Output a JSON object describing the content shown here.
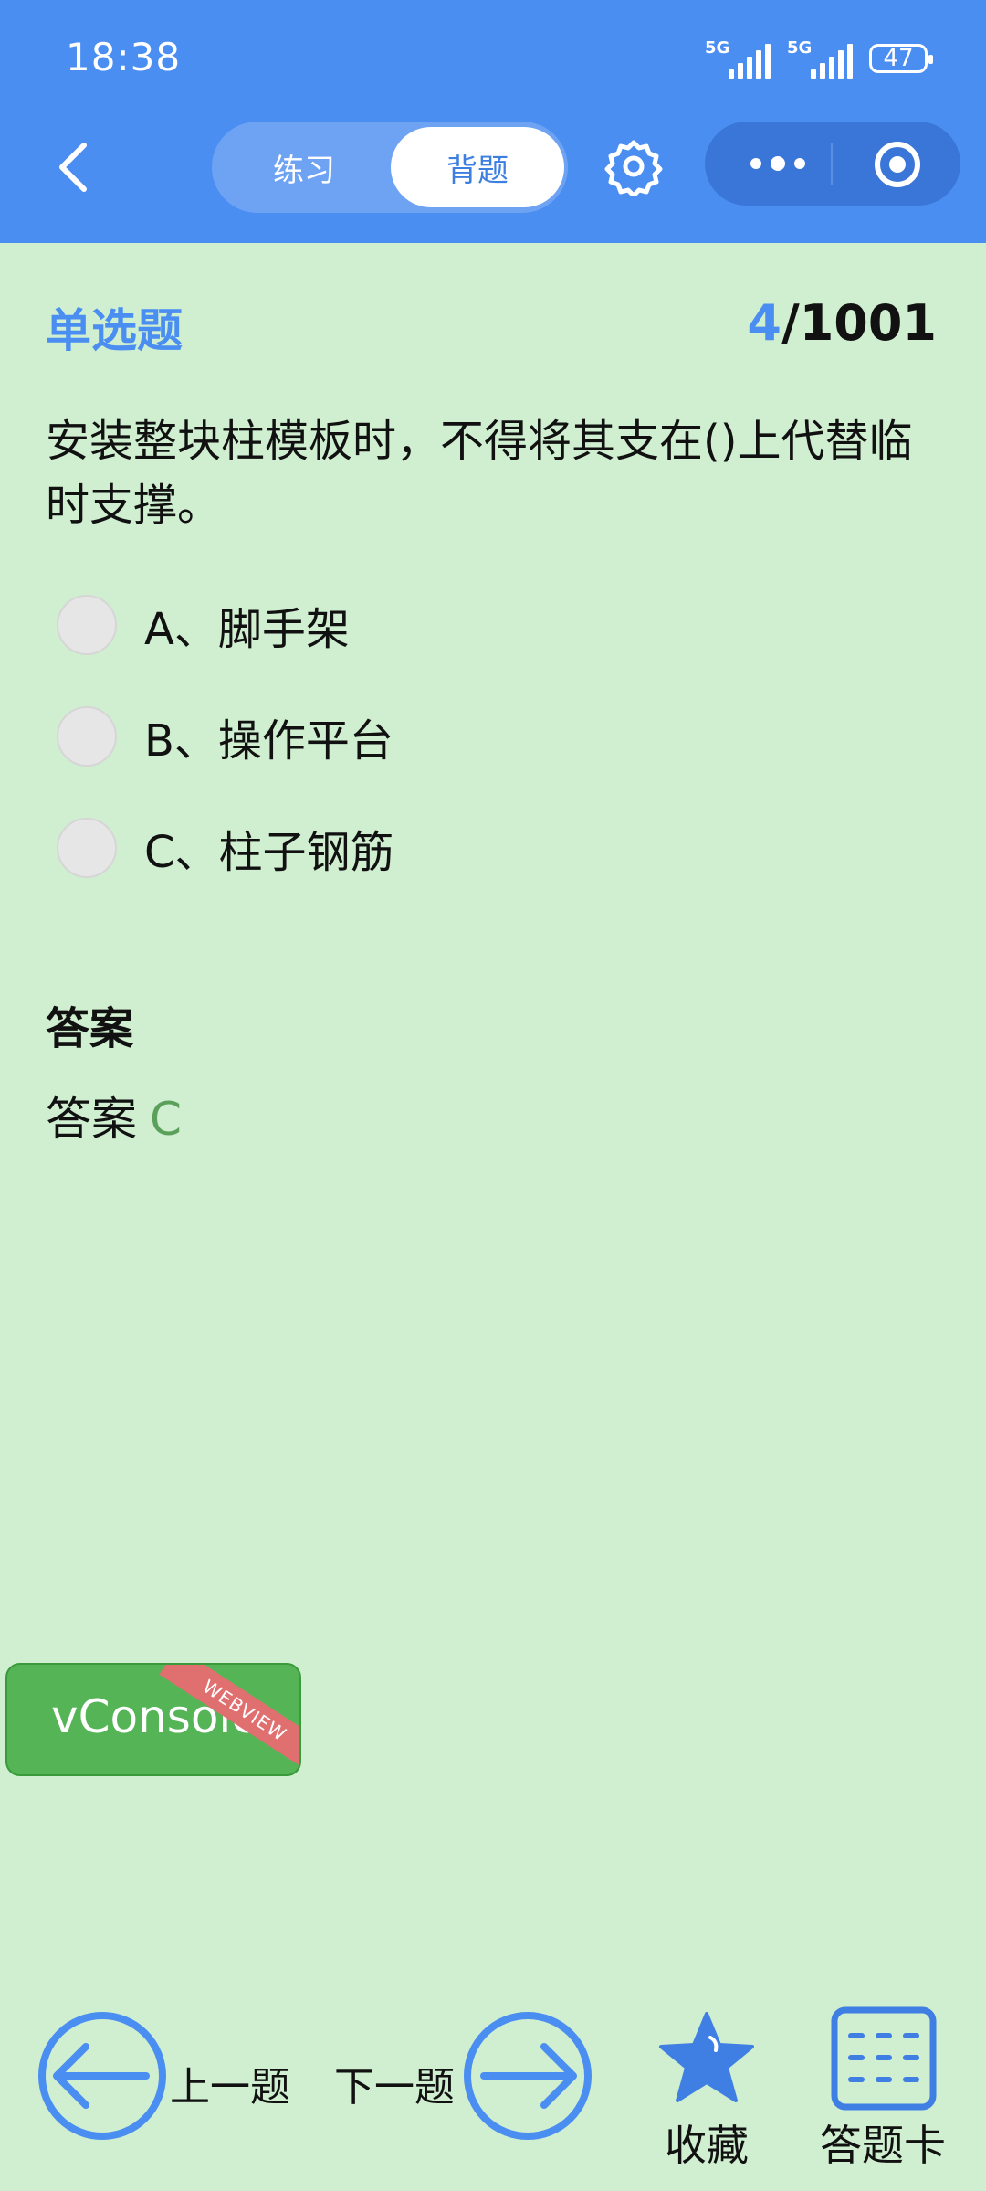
{
  "status_bar": {
    "time": "18:38",
    "signal1_label": "5G",
    "signal2_label": "5G",
    "battery": "47"
  },
  "header": {
    "tabs": [
      {
        "label": "练习",
        "active": false
      },
      {
        "label": "背题",
        "active": true
      }
    ],
    "icons": [
      "back-arrow-icon",
      "settings-gear-icon",
      "more-dots-icon",
      "target-circle-icon"
    ]
  },
  "question": {
    "type": "单选题",
    "current": "4",
    "total": "/1001",
    "text": "安装整块柱模板时，不得将其支在()上代替临时支撑。",
    "options": [
      {
        "label": "A、脚手架"
      },
      {
        "label": "B、操作平台"
      },
      {
        "label": "C、柱子钢筋"
      }
    ]
  },
  "answer": {
    "heading": "答案",
    "prefix": "答案",
    "value": "C",
    "value_color": "#5aa05a"
  },
  "vconsole": {
    "label": "vConsole",
    "ribbon": "WEBVIEW"
  },
  "bottom_nav": {
    "prev_label": "上一题",
    "next_label": "下一题",
    "favorite_label": "收藏",
    "card_label": "答题卡"
  },
  "colors": {
    "accent": "#4a8ef2",
    "background": "#d0eed0"
  }
}
